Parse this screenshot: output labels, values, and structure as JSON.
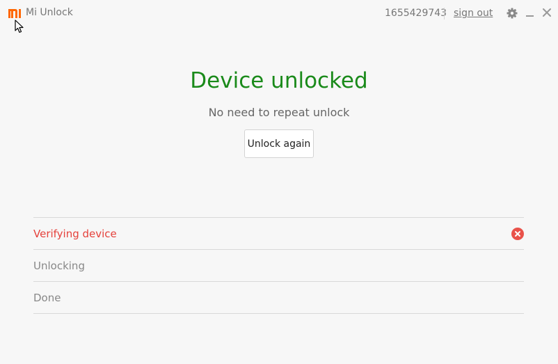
{
  "app": {
    "title": "Mi Unlock",
    "logo_icon": "mi-logo-icon",
    "brand_color": "#ff6700"
  },
  "header": {
    "user_id": "1655429743",
    "sign_out_label": "sign out",
    "settings_icon": "gear-icon",
    "minimize_icon": "minimize-icon",
    "close_icon": "close-icon"
  },
  "status": {
    "title": "Device unlocked",
    "subtitle": "No need to repeat unlock",
    "button_label": "Unlock again",
    "title_color": "#1a8a1a"
  },
  "steps": [
    {
      "label": "Verifying device",
      "state": "error",
      "icon": "error-x-circle-icon",
      "color": "#e5413b"
    },
    {
      "label": "Unlocking",
      "state": "pending"
    },
    {
      "label": "Done",
      "state": "pending"
    }
  ]
}
